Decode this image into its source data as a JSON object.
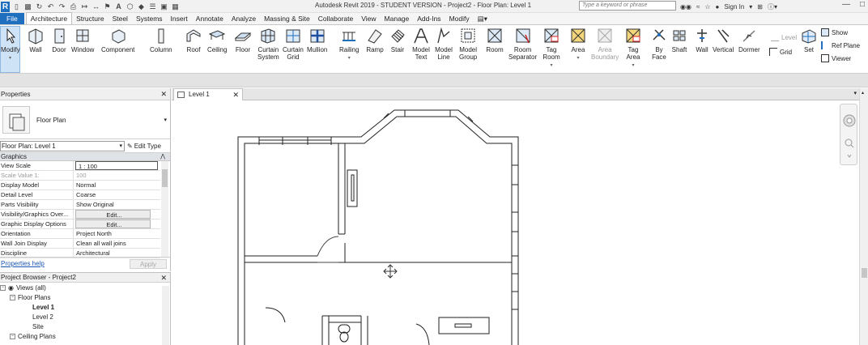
{
  "app": {
    "title": "Autodesk Revit 2019 - STUDENT VERSION - Project2 - Floor Plan: Level 1",
    "search_placeholder": "Type a keyword or phrase",
    "sign_in": "Sign In"
  },
  "tabs": [
    "File",
    "Architecture",
    "Structure",
    "Steel",
    "Systems",
    "Insert",
    "Annotate",
    "Analyze",
    "Massing & Site",
    "Collaborate",
    "View",
    "Manage",
    "Add-Ins",
    "Modify"
  ],
  "ribbon": {
    "modify": "Modify",
    "wall": "Wall",
    "door": "Door",
    "window": "Window",
    "component": "Component",
    "column": "Column",
    "roof": "Roof",
    "ceiling": "Ceiling",
    "floor": "Floor",
    "curtain_system_1": "Curtain",
    "curtain_system_2": "System",
    "curtain_grid_1": "Curtain",
    "curtain_grid_2": "Grid",
    "mullion": "Mullion",
    "railing": "Railing",
    "ramp": "Ramp",
    "stair": "Stair",
    "model_text_1": "Model",
    "model_text_2": "Text",
    "model_line_1": "Model",
    "model_line_2": "Line",
    "model_group_1": "Model",
    "model_group_2": "Group",
    "room": "Room",
    "room_separator_1": "Room",
    "room_separator_2": "Separator",
    "tag_room_1": "Tag",
    "tag_room_2": "Room",
    "area": "Area",
    "area_boundary_1": "Area",
    "area_boundary_2": "Boundary",
    "tag_area_1": "Tag",
    "tag_area_2": "Area",
    "by_face_1": "By",
    "by_face_2": "Face",
    "shaft": "Shaft",
    "wall_opening": "Wall",
    "vertical": "Vertical",
    "dormer": "Dormer",
    "level": "Level",
    "grid": "Grid",
    "set": "Set",
    "show": "Show",
    "ref_plane": "Ref Plane",
    "viewer": "Viewer"
  },
  "properties": {
    "header": "Properties",
    "type_name": "Floor Plan",
    "instance": "Floor Plan: Level 1",
    "edit_type": "Edit Type",
    "group": "Graphics",
    "rows": [
      {
        "k": "View Scale",
        "v": "1 : 100"
      },
      {
        "k": "Scale Value    1:",
        "v": "100"
      },
      {
        "k": "Display Model",
        "v": "Normal"
      },
      {
        "k": "Detail Level",
        "v": "Coarse"
      },
      {
        "k": "Parts Visibility",
        "v": "Show Original"
      },
      {
        "k": "Visibility/Graphics Over...",
        "v": "Edit..."
      },
      {
        "k": "Graphic Display Options",
        "v": "Edit..."
      },
      {
        "k": "Orientation",
        "v": "Project North"
      },
      {
        "k": "Wall Join Display",
        "v": "Clean all wall joins"
      },
      {
        "k": "Discipline",
        "v": "Architectural"
      }
    ],
    "help": "Properties help",
    "apply": "Apply"
  },
  "browser": {
    "header": "Project Browser - Project2",
    "views": "Views (all)",
    "floor_plans": "Floor Plans",
    "level1": "Level 1",
    "level2": "Level 2",
    "site": "Site",
    "ceiling_plans": "Ceiling Plans"
  },
  "view_tab": {
    "name": "Level 1"
  },
  "colors": {
    "accent": "#1f6fbf",
    "wall": "#222222"
  }
}
